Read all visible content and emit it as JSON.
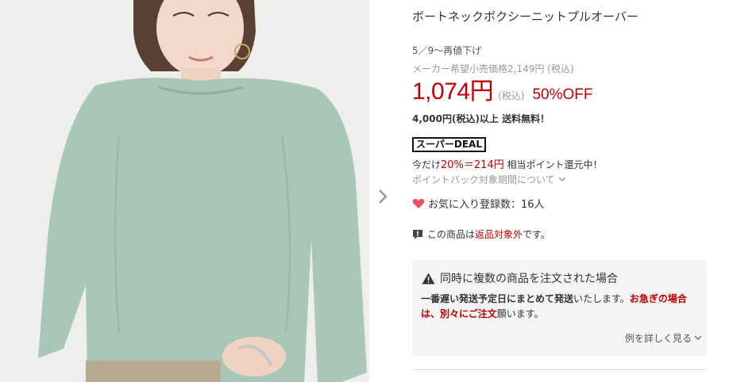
{
  "product": {
    "title": "ボートネックボクシーニットプルオーバー",
    "resale_note": "5／9〜再値下げ",
    "msrp": "メーカー希望小売価格2,149円 (税込)",
    "price": "1,074円",
    "tax_label": "(税込)",
    "discount": "50%OFF",
    "shipping": "4,000円(税込)以上 送料無料！",
    "image_alt": "model wearing mint green knit pullover"
  },
  "deal": {
    "badge": "スーパーDEAL",
    "points_prefix": "今だけ",
    "points_value": "20%＝214円",
    "points_suffix": " 相当ポイント還元中！",
    "pointback_link": "ポイントバック対象期間について"
  },
  "favorites": {
    "label": "お気に入り登録数：16人"
  },
  "returns": {
    "prefix": "この商品は",
    "highlight": "返品対象外",
    "suffix": "です。"
  },
  "notice": {
    "title": "同時に複数の商品を注文された場合",
    "line1_bold": "一番遅い発送予定日にまとめて発送",
    "line1_normal": "いたします。",
    "line1_red": "お急ぎの場合",
    "line2_red": "は、別々にご注文",
    "line2_normal": "願います。",
    "more_link": "例を詳しく見る"
  },
  "colors": {
    "accent_red": "#bf0000",
    "sweater": "#a9c7b9",
    "background": "#eeeeec"
  },
  "icons": [
    "chevron-right-icon",
    "chevron-down-icon",
    "heart-icon",
    "alert-bubble-icon",
    "warning-icon"
  ]
}
